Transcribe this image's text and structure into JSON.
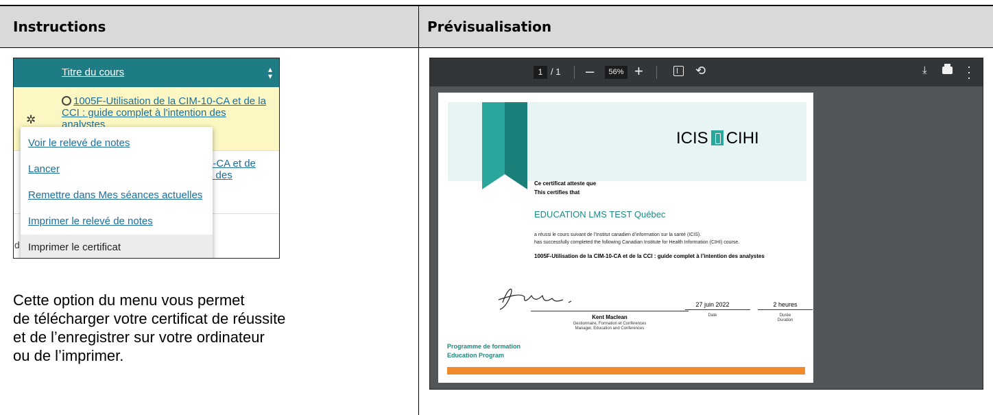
{
  "table": {
    "headers": [
      "Instructions",
      "Prévisualisation"
    ]
  },
  "menu_screenshot": {
    "column_title": "Titre du cours",
    "course_link": "1005F-Utilisation de la CIM-10-CA et de la CCI : guide complet à l'intention des analystes",
    "behind_row_line1": "0-CA et de",
    "behind_row_line2": "n des",
    "behind_row_bottom": "d",
    "menu_items": [
      "Voir le relevé de notes",
      "Lancer",
      "Remettre dans Mes séances actuelles",
      "Imprimer le relevé de notes",
      "Imprimer le certificat"
    ],
    "highlighted_item": "Imprimer le certificat",
    "colors": {
      "header_bg": "#1e7c84",
      "row_highlight_bg": "#fdf7c3",
      "link": "#1a6ea0"
    }
  },
  "description": [
    "Cette option du menu vous permet",
    "de télécharger votre certificat de réussite",
    "et de l’enregistrer sur votre ordinateur",
    "ou de l’imprimer."
  ],
  "pdf_viewer": {
    "current_page": "1",
    "total_pages": "/ 1",
    "zoom": "56%",
    "minus_label": "–",
    "plus_label": "+",
    "icons": [
      "minus-icon",
      "plus-icon",
      "fit-page-icon",
      "rotate-icon",
      "download-icon",
      "print-icon",
      "more-options-icon"
    ]
  },
  "certificate": {
    "logo_left": "ICIS",
    "logo_right": "CIHI",
    "line_fr": "Ce certificat atteste que",
    "line_en": "This certifies that",
    "recipient": "EDUCATION LMS TEST Québec",
    "completed_fr": "a réussi le cours suivant de l’Institut canadien d’information sur la santé (ICIS).",
    "completed_en": "has successfully completed the following Canadian Institute for Health Information (CIHI) course.",
    "course": "1005F-Utilisation de la CIM-10-CA et de la CCI : guide complet à l’intention des analystes",
    "signer_name": "Kent Maclean",
    "signer_role_fr": "Gestionnaire, Formation et Conférences",
    "signer_role_en": "Manager, Education and Conferences",
    "date_value": "27 juin 2022",
    "date_label": "Date",
    "duration_value": "2 heures",
    "duration_label_fr": "Durée",
    "duration_label_en": "Duration",
    "program_fr": "Programme de formation",
    "program_en": "Education Program",
    "colors": {
      "teal": "#1a8a83",
      "band_bg": "#e6f4f3",
      "orange": "#f08a2a"
    }
  }
}
